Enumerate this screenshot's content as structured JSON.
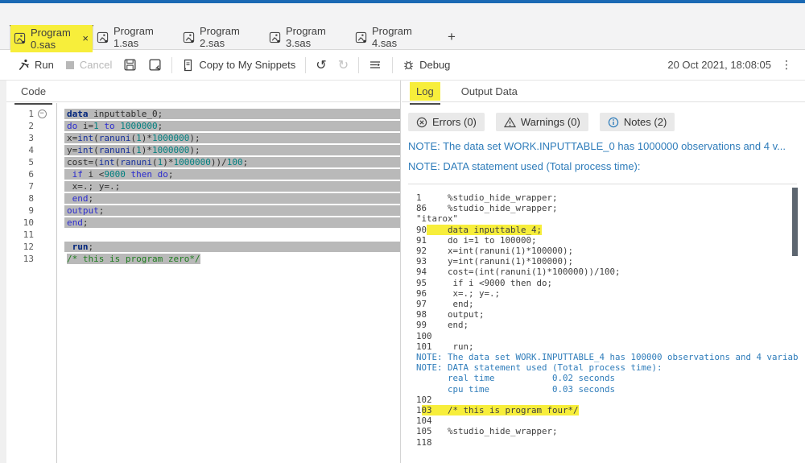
{
  "colors": {
    "accent_blue": "#1a69b4",
    "highlight_yellow": "#f7ee3b",
    "note_blue": "#2e7cba",
    "selection_gray": "#b9b9b9"
  },
  "tabs": {
    "items": [
      {
        "label": "Program 0.sas",
        "active": true,
        "closable": true,
        "highlighted": true
      },
      {
        "label": "Program 1.sas",
        "active": false,
        "closable": false,
        "highlighted": false
      },
      {
        "label": "Program 2.sas",
        "active": false,
        "closable": false,
        "highlighted": false
      },
      {
        "label": "Program 3.sas",
        "active": false,
        "closable": false,
        "highlighted": false
      },
      {
        "label": "Program 4.sas",
        "active": false,
        "closable": false,
        "highlighted": false
      }
    ],
    "add_label": "+"
  },
  "toolbar": {
    "run_label": "Run",
    "cancel_label": "Cancel",
    "copy_label": "Copy to My Snippets",
    "debug_label": "Debug",
    "timestamp": "20 Oct 2021, 18:08:05",
    "undo_glyph": "↺",
    "redo_glyph": "↻",
    "kebab_glyph": "⋮"
  },
  "editor": {
    "tab_label": "Code",
    "fold_glyph": "−",
    "lines": [
      {
        "num": "1",
        "fold": true,
        "sel": "full",
        "tokens": [
          [
            "kwb",
            "data"
          ],
          [
            "t",
            " inputtable_0;"
          ]
        ]
      },
      {
        "num": "2",
        "fold": false,
        "sel": "full",
        "tokens": [
          [
            "kw",
            "do"
          ],
          [
            "t",
            " i="
          ],
          [
            "num",
            "1"
          ],
          [
            "t",
            " "
          ],
          [
            "kw",
            "to"
          ],
          [
            "t",
            " "
          ],
          [
            "num",
            "1000000"
          ],
          [
            "t",
            ";"
          ]
        ]
      },
      {
        "num": "3",
        "fold": false,
        "sel": "full",
        "tokens": [
          [
            "t",
            "x="
          ],
          [
            "fn",
            "int"
          ],
          [
            "t",
            "("
          ],
          [
            "fn",
            "ranuni"
          ],
          [
            "t",
            "("
          ],
          [
            "num",
            "1"
          ],
          [
            "t",
            ")*"
          ],
          [
            "num",
            "1000000"
          ],
          [
            "t",
            ");"
          ]
        ]
      },
      {
        "num": "4",
        "fold": false,
        "sel": "full",
        "tokens": [
          [
            "t",
            "y="
          ],
          [
            "fn",
            "int"
          ],
          [
            "t",
            "("
          ],
          [
            "fn",
            "ranuni"
          ],
          [
            "t",
            "("
          ],
          [
            "num",
            "1"
          ],
          [
            "t",
            ")*"
          ],
          [
            "num",
            "1000000"
          ],
          [
            "t",
            ");"
          ]
        ]
      },
      {
        "num": "5",
        "fold": false,
        "sel": "full",
        "tokens": [
          [
            "t",
            "cost=("
          ],
          [
            "fn",
            "int"
          ],
          [
            "t",
            "("
          ],
          [
            "fn",
            "ranuni"
          ],
          [
            "t",
            "("
          ],
          [
            "num",
            "1"
          ],
          [
            "t",
            ")*"
          ],
          [
            "num",
            "1000000"
          ],
          [
            "t",
            "))/"
          ],
          [
            "num",
            "100"
          ],
          [
            "t",
            ";"
          ]
        ]
      },
      {
        "num": "6",
        "fold": false,
        "sel": "full",
        "tokens": [
          [
            "t",
            " "
          ],
          [
            "kw",
            "if"
          ],
          [
            "t",
            " i <"
          ],
          [
            "num",
            "9000"
          ],
          [
            "t",
            " "
          ],
          [
            "kw",
            "then"
          ],
          [
            "t",
            " "
          ],
          [
            "kw",
            "do"
          ],
          [
            "t",
            ";"
          ]
        ]
      },
      {
        "num": "7",
        "fold": false,
        "sel": "full",
        "tokens": [
          [
            "t",
            " x=.; y=.;"
          ]
        ]
      },
      {
        "num": "8",
        "fold": false,
        "sel": "full",
        "tokens": [
          [
            "t",
            " "
          ],
          [
            "kw",
            "end"
          ],
          [
            "t",
            ";"
          ]
        ]
      },
      {
        "num": "9",
        "fold": false,
        "sel": "full",
        "tokens": [
          [
            "kw",
            "output"
          ],
          [
            "t",
            ";"
          ]
        ]
      },
      {
        "num": "10",
        "fold": false,
        "sel": "full",
        "tokens": [
          [
            "kw",
            "end"
          ],
          [
            "t",
            ";"
          ]
        ]
      },
      {
        "num": "11",
        "fold": false,
        "sel": "full",
        "tokens": []
      },
      {
        "num": "12",
        "fold": false,
        "sel": "full",
        "tokens": [
          [
            "t",
            " "
          ],
          [
            "kwb",
            "run"
          ],
          [
            "t",
            ";"
          ]
        ]
      },
      {
        "num": "13",
        "fold": false,
        "sel": "text",
        "tokens": [
          [
            "c",
            "/* this is program zero*/"
          ]
        ]
      }
    ]
  },
  "log": {
    "log_tab_label": "Log",
    "output_tab_label": "Output Data",
    "badges": [
      {
        "label": "Errors (0)"
      },
      {
        "label": "Warnings (0)"
      },
      {
        "label": "Notes (2)"
      }
    ],
    "notes": [
      "NOTE: The data set WORK.INPUTTABLE_0 has 1000000 observations and 4 v...",
      "NOTE: DATA statement used (Total process time):"
    ],
    "lines": [
      [
        [
          "t",
          "1     %studio_hide_wrapper;"
        ]
      ],
      [
        [
          "t",
          "86    %studio_hide_wrapper;"
        ]
      ],
      [
        [
          "t",
          "\"itarox\""
        ]
      ],
      [
        [
          "t",
          "90"
        ],
        [
          "hl",
          "    data inputtable_4;"
        ]
      ],
      [
        [
          "t",
          "91    do i=1 to 100000;"
        ]
      ],
      [
        [
          "t",
          "92    x=int(ranuni(1)*100000);"
        ]
      ],
      [
        [
          "t",
          "93    y=int(ranuni(1)*100000);"
        ]
      ],
      [
        [
          "t",
          "94    cost=(int(ranuni(1)*100000))/100;"
        ]
      ],
      [
        [
          "t",
          "95     if i <9000 then do;"
        ]
      ],
      [
        [
          "t",
          "96     x=.; y=.;"
        ]
      ],
      [
        [
          "t",
          "97     end;"
        ]
      ],
      [
        [
          "t",
          "98    output;"
        ]
      ],
      [
        [
          "t",
          "99    end;"
        ]
      ],
      [
        [
          "t",
          "100"
        ]
      ],
      [
        [
          "t",
          "101    run;"
        ]
      ],
      [
        [
          "note",
          "NOTE: The data set WORK.INPUTTABLE_4 has 100000 observations and 4 variab"
        ]
      ],
      [
        [
          "note",
          "NOTE: DATA statement used (Total process time):"
        ]
      ],
      [
        [
          "note",
          "      real time           0.02 seconds"
        ]
      ],
      [
        [
          "note",
          "      cpu time            0.03 seconds"
        ]
      ],
      [
        [
          "t",
          ""
        ]
      ],
      [
        [
          "t",
          "102"
        ]
      ],
      [
        [
          "t",
          "1"
        ],
        [
          "hl",
          "03   /* this is program four*/"
        ]
      ],
      [
        [
          "t",
          "104"
        ]
      ],
      [
        [
          "t",
          "105   %studio_hide_wrapper;"
        ]
      ],
      [
        [
          "t",
          "118"
        ]
      ]
    ]
  }
}
